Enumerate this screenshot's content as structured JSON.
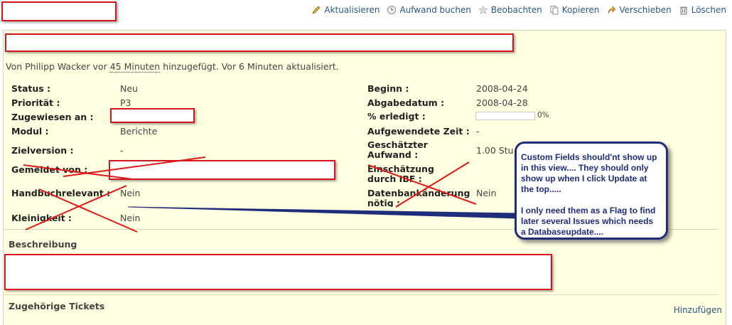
{
  "toolbar": {
    "update": "Aktualisieren",
    "log_time": "Aufwand buchen",
    "watch": "Beobachten",
    "copy": "Kopieren",
    "move": "Verschieben",
    "delete": "Löschen"
  },
  "meta": {
    "prefix": "Von Philipp Wacker vor",
    "added_ago": "45 Minuten",
    "suffix": "hinzugefügt. Vor 6 Minuten aktualisiert."
  },
  "left_attrs": [
    {
      "label": "Status :",
      "value": "Neu"
    },
    {
      "label": "Priorität :",
      "value": "P3"
    },
    {
      "label": "Zugewiesen an :",
      "value": ""
    },
    {
      "label": "Modul :",
      "value": "Berichte"
    },
    {
      "label": "Zielversion :",
      "value": "-"
    },
    {
      "label": "Gemeldet von :",
      "value": ""
    },
    {
      "label": "Handbuchrelevant :",
      "value": "Nein"
    },
    {
      "label": "Kleinigkeit :",
      "value": "Nein"
    }
  ],
  "right_attrs": [
    {
      "label": "Beginn :",
      "value": "2008-04-24"
    },
    {
      "label": "Abgabedatum :",
      "value": "2008-04-28"
    },
    {
      "label": "% erledigt :",
      "value": "0%"
    },
    {
      "label": "Aufgewendete Zeit :",
      "value": "-"
    },
    {
      "label": "Geschätzter Aufwand :",
      "value": "1.00 Stu"
    },
    {
      "label": "Einschätzung durch IBF :",
      "value": ""
    },
    {
      "label": "Datenbankänderung nötig :",
      "value": "Nein"
    }
  ],
  "progress": {
    "done_fraction": 0
  },
  "sections": {
    "description": "Beschreibung",
    "related": "Zugehörige Tickets",
    "add": "Hinzufügen"
  },
  "callout": {
    "p1": "Custom Fields should'nt show up in this view.... They should only show up when I click Update at the top.....",
    "p2": "I only need them as a Flag to find later several Issues which needs a Databaseupdate...."
  },
  "colors": {
    "redact": "#d4151c",
    "callout": "#1f2d7a",
    "panel_bg": "#ffffe1",
    "link": "#2a5685"
  }
}
